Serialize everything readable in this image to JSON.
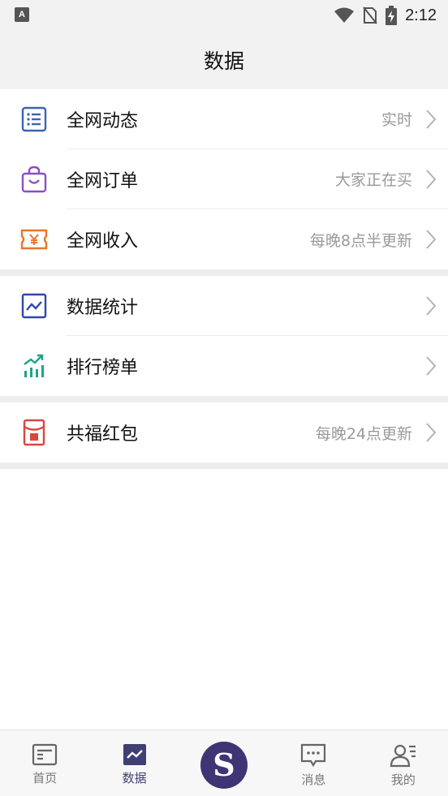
{
  "status_bar": {
    "left_badge": "A",
    "time": "2:12"
  },
  "header": {
    "title": "数据"
  },
  "groups": [
    {
      "items": [
        {
          "label": "全网动态",
          "value": "实时",
          "icon": "list-icon",
          "icon_color": "#3b63b6"
        },
        {
          "label": "全网订单",
          "value": "大家正在买",
          "icon": "shopping-bag-icon",
          "icon_color": "#8a4fc4"
        },
        {
          "label": "全网收入",
          "value": "每晚8点半更新",
          "icon": "yen-ticket-icon",
          "icon_color": "#e8762c"
        }
      ]
    },
    {
      "items": [
        {
          "label": "数据统计",
          "value": "",
          "icon": "line-chart-icon",
          "icon_color": "#2f47a8"
        },
        {
          "label": "排行榜单",
          "value": "",
          "icon": "bar-chart-up-icon",
          "icon_color": "#1fa38a"
        }
      ]
    },
    {
      "items": [
        {
          "label": "共福红包",
          "value": "每晚24点更新",
          "icon": "red-envelope-icon",
          "icon_color": "#d9473e"
        }
      ]
    }
  ],
  "bottom_nav": {
    "items": [
      {
        "label": "首页",
        "icon": "home-card-icon",
        "active": false
      },
      {
        "label": "数据",
        "icon": "data-chart-icon",
        "active": true
      },
      {
        "label": "",
        "icon": "dollar-circle-icon",
        "center": true,
        "symbol": "S"
      },
      {
        "label": "消息",
        "icon": "message-icon",
        "active": false
      },
      {
        "label": "我的",
        "icon": "profile-icon",
        "active": false
      }
    ]
  },
  "colors": {
    "accent": "#3f3574",
    "header_bg": "#f2f2f2",
    "muted_text": "#9a9a9a"
  }
}
